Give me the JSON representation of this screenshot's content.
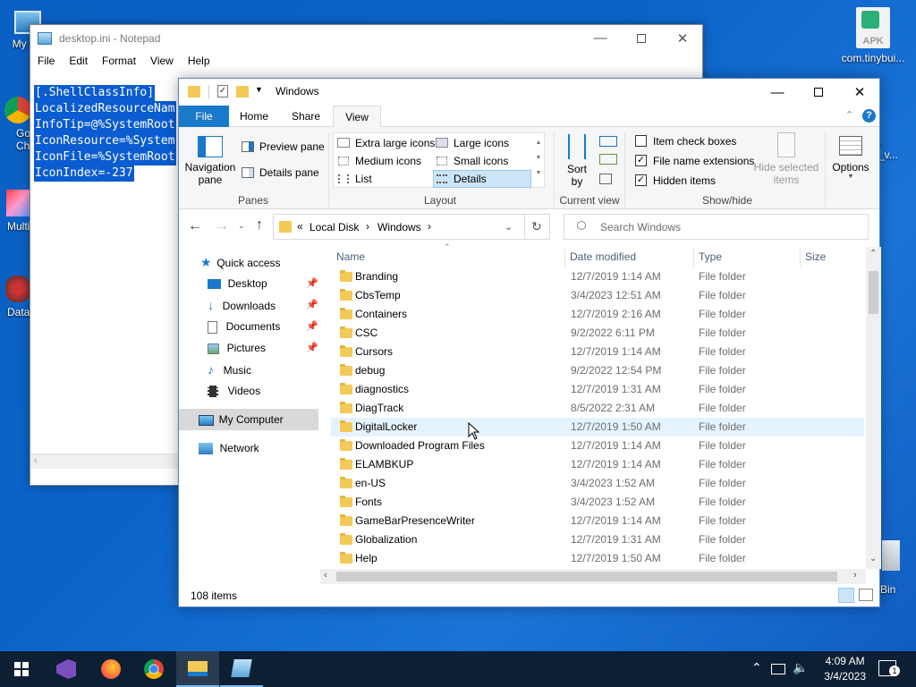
{
  "desktop": {
    "icons": [
      {
        "label": "My Co"
      },
      {
        "label": "Go Ch"
      },
      {
        "label": "Multi"
      },
      {
        "label": "DataW"
      },
      {
        "label": "com.tinybui..."
      },
      {
        "label": "o\nr_v..."
      },
      {
        "label": "Bin"
      }
    ],
    "apk_text": "APK"
  },
  "notepad": {
    "title": "desktop.ini - Notepad",
    "menu": [
      "File",
      "Edit",
      "Format",
      "View",
      "Help"
    ],
    "lines": [
      "[.ShellClassInfo]",
      "LocalizedResourceNam",
      "InfoTip=@%SystemRoot",
      "IconResource=%System",
      "IconFile=%SystemRoot",
      "IconIndex=-237"
    ]
  },
  "explorer": {
    "title": "Windows",
    "tabs": [
      "File",
      "Home",
      "Share",
      "View"
    ],
    "active_tab": "View",
    "ribbon": {
      "panes": {
        "navigation_pane": "Navigation\npane",
        "preview_pane": "Preview pane",
        "details_pane": "Details pane",
        "group": "Panes"
      },
      "layout": {
        "extra_large": "Extra large icons",
        "large": "Large icons",
        "medium": "Medium icons",
        "small": "Small icons",
        "list": "List",
        "details": "Details",
        "group": "Layout"
      },
      "current_view": {
        "sort_by": "Sort\nby",
        "group": "Current view"
      },
      "show_hide": {
        "item_check_boxes": "Item check boxes",
        "file_name_extensions": "File name extensions",
        "hidden_items": "Hidden items",
        "hide_selected": "Hide selected\nitems",
        "group": "Show/hide"
      },
      "options": "Options"
    },
    "checkboxes": {
      "item_check_boxes": false,
      "file_name_extensions": true,
      "hidden_items": true
    },
    "address": {
      "crumbs": [
        "Local Disk",
        "Windows"
      ],
      "search_placeholder": "Search Windows"
    },
    "nav": {
      "quick_access": "Quick access",
      "items": [
        "Desktop",
        "Downloads",
        "Documents",
        "Pictures",
        "Music",
        "Videos"
      ],
      "my_computer": "My Computer",
      "network": "Network"
    },
    "columns": [
      "Name",
      "Date modified",
      "Type",
      "Size"
    ],
    "files": [
      {
        "name": "Branding",
        "date": "12/7/2019 1:14 AM",
        "type": "File folder"
      },
      {
        "name": "CbsTemp",
        "date": "3/4/2023 12:51 AM",
        "type": "File folder"
      },
      {
        "name": "Containers",
        "date": "12/7/2019 2:16 AM",
        "type": "File folder"
      },
      {
        "name": "CSC",
        "date": "9/2/2022 6:11 PM",
        "type": "File folder"
      },
      {
        "name": "Cursors",
        "date": "12/7/2019 1:14 AM",
        "type": "File folder"
      },
      {
        "name": "debug",
        "date": "9/2/2022 12:54 PM",
        "type": "File folder"
      },
      {
        "name": "diagnostics",
        "date": "12/7/2019 1:31 AM",
        "type": "File folder"
      },
      {
        "name": "DiagTrack",
        "date": "8/5/2022 2:31 AM",
        "type": "File folder"
      },
      {
        "name": "DigitalLocker",
        "date": "12/7/2019 1:50 AM",
        "type": "File folder"
      },
      {
        "name": "Downloaded Program Files",
        "date": "12/7/2019 1:14 AM",
        "type": "File folder"
      },
      {
        "name": "ELAMBKUP",
        "date": "12/7/2019 1:14 AM",
        "type": "File folder"
      },
      {
        "name": "en-US",
        "date": "3/4/2023 1:52 AM",
        "type": "File folder"
      },
      {
        "name": "Fonts",
        "date": "3/4/2023 1:52 AM",
        "type": "File folder"
      },
      {
        "name": "GameBarPresenceWriter",
        "date": "12/7/2019 1:14 AM",
        "type": "File folder"
      },
      {
        "name": "Globalization",
        "date": "12/7/2019 1:31 AM",
        "type": "File folder"
      },
      {
        "name": "Help",
        "date": "12/7/2019 1:50 AM",
        "type": "File folder"
      }
    ],
    "status": "108 items"
  },
  "taskbar": {
    "time": "4:09 AM",
    "date": "3/4/2023",
    "notification_count": "1"
  }
}
